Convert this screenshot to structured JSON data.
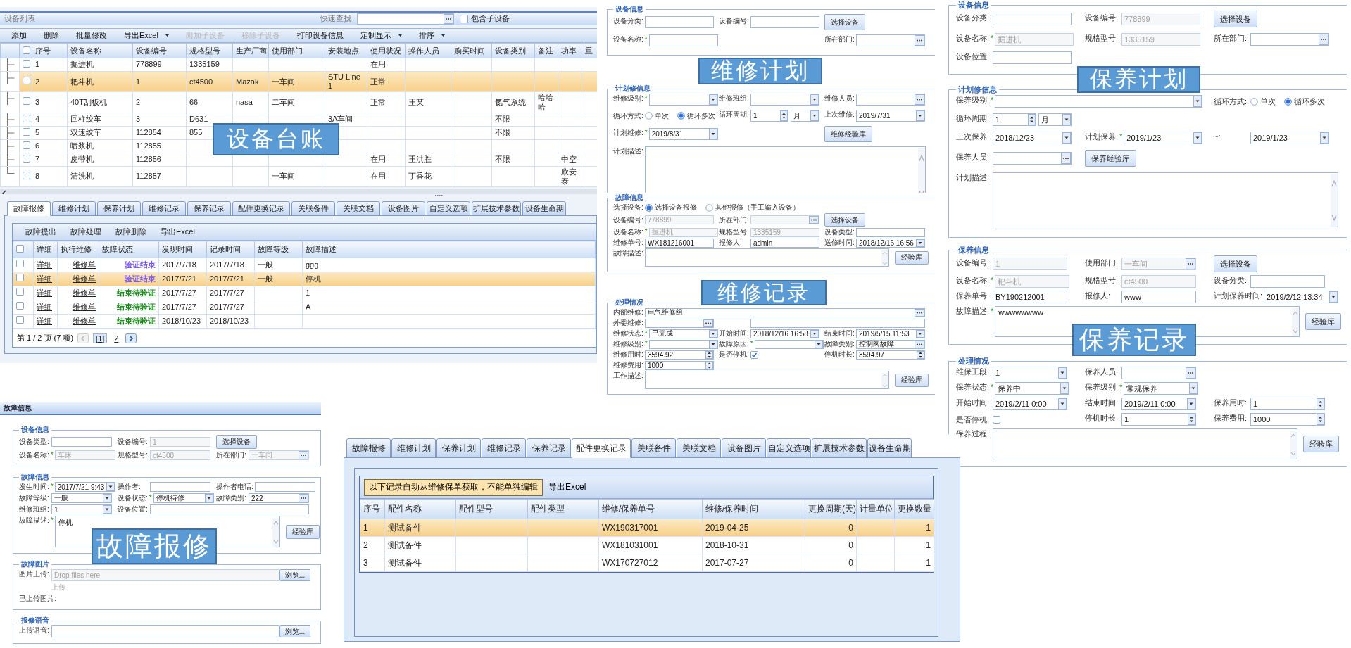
{
  "equipment_list": {
    "title": "设备列表",
    "quick_search_label": "快速查找",
    "include_children": {
      "label": "包含子设备",
      "checked": false
    },
    "toolbar": [
      {
        "label": "添加",
        "disabled": false,
        "dropdown": false
      },
      {
        "label": "删除",
        "disabled": false,
        "dropdown": false
      },
      {
        "label": "批量修改",
        "disabled": false,
        "dropdown": false
      },
      {
        "label": "导出Excel",
        "disabled": false,
        "dropdown": true
      },
      {
        "label": "附加子设备",
        "disabled": true,
        "dropdown": false
      },
      {
        "label": "移除子设备",
        "disabled": true,
        "dropdown": false
      },
      {
        "label": "打印设备信息",
        "disabled": false,
        "dropdown": false
      },
      {
        "label": "定制显示",
        "disabled": false,
        "dropdown": true
      },
      {
        "label": "排序",
        "disabled": false,
        "dropdown": true
      }
    ],
    "select_all": {
      "checked": false
    },
    "columns": [
      "序号",
      "设备名称",
      "设备编号",
      "规格型号",
      "生产厂商",
      "使用部门",
      "安装地点",
      "使用状况",
      "操作人员",
      "购买时间",
      "设备类别",
      "备注",
      "功率",
      "重"
    ],
    "rows": [
      {
        "selected": false,
        "checked": false,
        "cells": [
          "1",
          "掘进机",
          "778899",
          "1335159",
          null,
          null,
          null,
          "在用",
          null,
          null,
          null,
          null,
          null,
          null
        ]
      },
      {
        "selected": true,
        "checked": false,
        "cells": [
          "2",
          "耙斗机",
          "1",
          "ct4500",
          "Mazak",
          "一车间",
          "STU Line1",
          "正常",
          null,
          null,
          null,
          null,
          null,
          null
        ]
      },
      {
        "selected": false,
        "checked": false,
        "cells": [
          "3",
          "40T刮板机",
          "2",
          "66",
          "nasa",
          "二车间",
          null,
          "正常",
          "王某",
          null,
          "氮气系统",
          "哈哈哈",
          null,
          null
        ]
      },
      {
        "selected": false,
        "checked": false,
        "cells": [
          "4",
          "回柱绞车",
          "3",
          "D631",
          null,
          null,
          "3A车间",
          null,
          null,
          null,
          "不限",
          null,
          null,
          null
        ]
      },
      {
        "selected": false,
        "checked": false,
        "cells": [
          "5",
          "双速绞车",
          "112854",
          "855",
          null,
          null,
          null,
          null,
          null,
          null,
          "不限",
          null,
          null,
          null
        ]
      },
      {
        "selected": false,
        "checked": false,
        "cells": [
          "6",
          "喷浆机",
          "112855",
          null,
          null,
          null,
          null,
          null,
          null,
          null,
          null,
          null,
          null,
          null
        ]
      },
      {
        "selected": false,
        "checked": false,
        "cells": [
          "7",
          "皮带机",
          "112856",
          null,
          null,
          null,
          null,
          "在用",
          "王洪胜",
          null,
          "不限",
          null,
          "中空",
          null
        ]
      },
      {
        "selected": false,
        "checked": false,
        "cells": [
          "8",
          "清洗机",
          "112857",
          null,
          null,
          "一车间",
          null,
          "在用",
          "丁香花",
          null,
          null,
          null,
          "欣安泰",
          null
        ]
      }
    ],
    "banner": "设备台账"
  },
  "record_tabs": {
    "tabs": [
      {
        "label": "故障报修",
        "selected": true
      },
      {
        "label": "维修计划",
        "selected": false
      },
      {
        "label": "保养计划",
        "selected": false
      },
      {
        "label": "维修记录",
        "selected": false
      },
      {
        "label": "保养记录",
        "selected": false
      },
      {
        "label": "配件更换记录",
        "selected": false
      },
      {
        "label": "关联备件",
        "selected": false
      },
      {
        "label": "关联文档",
        "selected": false
      },
      {
        "label": "设备图片",
        "selected": false
      },
      {
        "label": "自定义选项",
        "selected": false
      },
      {
        "label": "扩展技术参数",
        "selected": false
      },
      {
        "label": "设备生命期",
        "selected": false
      }
    ],
    "toolbar": [
      "故障提出",
      "故障处理",
      "故障删除",
      "导出Excel"
    ],
    "select_all": {
      "checked": false
    },
    "columns": [
      "详细",
      "执行维修",
      "故障状态",
      "发现时间",
      "记录时间",
      "故障等级",
      "故障描述"
    ],
    "rows": [
      {
        "selected": false,
        "checked": false,
        "detail": "详细",
        "order": "维修单",
        "status": {
          "text": "验证结束",
          "color": "#7b5cf0"
        },
        "found": "2017/7/18",
        "recorded": "2017/7/18",
        "level": "一般",
        "description": "ggg"
      },
      {
        "selected": true,
        "checked": false,
        "detail": "详细",
        "order": "维修单",
        "status": {
          "text": "验证结束",
          "color": "#7b5cf0"
        },
        "found": "2017/7/21",
        "recorded": "2017/7/21",
        "level": "一般",
        "description": "停机"
      },
      {
        "selected": false,
        "checked": false,
        "detail": "详细",
        "order": "维修单",
        "status": {
          "text": "结束待验证",
          "color": "#1a8a1a"
        },
        "found": "2017/7/27",
        "recorded": "2017/7/27",
        "level": null,
        "description": "1"
      },
      {
        "selected": false,
        "checked": false,
        "detail": "详细",
        "order": "维修单",
        "status": {
          "text": "结束待验证",
          "color": "#1a8a1a"
        },
        "found": "2017/7/27",
        "recorded": "2017/7/27",
        "level": null,
        "description": "A"
      },
      {
        "selected": false,
        "checked": false,
        "detail": "详细",
        "order": "维修单",
        "status": {
          "text": "结束待验证",
          "color": "#1a8a1a"
        },
        "found": "2018/10/23",
        "recorded": "2018/10/23",
        "level": null,
        "description": null
      }
    ],
    "pager": {
      "summary": "第 1 / 2 页 (7 项)",
      "prev_disabled": true,
      "pages": [
        {
          "label": "[1]",
          "selected": true
        },
        {
          "label": "2",
          "selected": false
        }
      ]
    }
  },
  "maintenance_plan_form": {
    "banner": "维修计划",
    "sections": [
      {
        "legend": "设备信息",
        "rows": [
          {
            "items": [
              {
                "label": "设备分类:",
                "kind": "text"
              },
              {
                "label": "设备编号:",
                "kind": "text"
              },
              {
                "kind": "button",
                "label": "选择设备"
              }
            ]
          },
          {
            "items": [
              {
                "label": "设备名称:",
                "asterisk": "*",
                "kind": "text"
              },
              {
                "label": "所在部门:",
                "kind": "lookup"
              }
            ]
          }
        ]
      },
      {
        "legend": "计划修信息",
        "rows": [
          {
            "items": [
              {
                "label": "维修级别:",
                "asterisk": "*",
                "kind": "select"
              },
              {
                "label": "维修班组:",
                "kind": "select"
              },
              {
                "label": "维修人员:",
                "kind": "lookup"
              }
            ]
          },
          {
            "items": [
              {
                "label": "循环方式:",
                "kind": "radio",
                "options": [
                  {
                    "label": "单次",
                    "selected": false
                  },
                  {
                    "label": "循环多次",
                    "selected": true
                  }
                ]
              },
              {
                "label": "循环周期:",
                "kind": "spin_unit",
                "value": "1",
                "unit": "月"
              },
              {
                "label": "上次维修:",
                "kind": "date",
                "value": "2019/7/31"
              }
            ]
          },
          {
            "items": [
              {
                "label": "计划维修:",
                "asterisk": "*",
                "kind": "date",
                "value": "2019/8/31"
              },
              {
                "kind": "button",
                "label": "维修经验库"
              }
            ]
          },
          {
            "items": [
              {
                "label": "计划描述:",
                "kind": "textarea"
              }
            ]
          }
        ]
      }
    ]
  },
  "repair_record_form": {
    "banner": "维修记录",
    "sections": [
      {
        "legend": "故障信息",
        "rows": [
          {
            "items": [
              {
                "label": "选择设备:",
                "kind": "radio",
                "options": [
                  {
                    "label": "选择设备报修",
                    "selected": true
                  },
                  {
                    "label": "其他报修（手工输入设备）",
                    "selected": false
                  }
                ]
              }
            ]
          },
          {
            "items": [
              {
                "label": "设备编号:",
                "kind": "text",
                "value": "778899",
                "disabled": true
              },
              {
                "label": "所在部门:",
                "kind": "lookup",
                "disabled": true
              },
              {
                "kind": "button",
                "label": "选择设备"
              }
            ]
          },
          {
            "items": [
              {
                "label": "设备名称:",
                "asterisk": "*",
                "kind": "text",
                "value": "掘进机",
                "disabled": true
              },
              {
                "label": "规格型号:",
                "kind": "text",
                "value": "1335159",
                "disabled": true
              },
              {
                "label": "设备类型:",
                "kind": "text"
              }
            ]
          },
          {
            "items": [
              {
                "label": "维修单号:",
                "kind": "text",
                "value": "WX181216001"
              },
              {
                "label": "报修人:",
                "kind": "text",
                "value": "admin"
              },
              {
                "label": "送修时间:",
                "kind": "date",
                "value": "2018/12/16 16:56"
              }
            ]
          },
          {
            "items": [
              {
                "label": "故障描述:",
                "kind": "textarea",
                "button": "经验库"
              }
            ]
          }
        ]
      },
      {
        "legend": "处理情况",
        "rows": [
          {
            "items": [
              {
                "label": "内部维修:",
                "kind": "long_lookup",
                "value": "电气维修组"
              }
            ]
          },
          {
            "items": [
              {
                "label": "外委维修:",
                "kind": "lookup"
              },
              {
                "kind": "long_text"
              }
            ]
          },
          {
            "items": [
              {
                "label": "维修状态:",
                "asterisk": "*",
                "kind": "select",
                "value": "已完成"
              },
              {
                "label": "开始时间:",
                "kind": "date",
                "value": "2018/12/16 16:58"
              },
              {
                "label": "结束时间:",
                "kind": "date",
                "value": "2019/5/15 11:53"
              }
            ]
          },
          {
            "items": [
              {
                "label": "维修级别:",
                "asterisk": "*",
                "kind": "select"
              },
              {
                "label": "故障原因:",
                "asterisk": "*",
                "kind": "select"
              },
              {
                "label": "故障类别:",
                "kind": "lookup",
                "value": "控制阀故障"
              }
            ]
          },
          {
            "items": [
              {
                "label": "维修用时:",
                "kind": "spin",
                "value": "3594.92"
              },
              {
                "label": "是否停机:",
                "kind": "checkbox",
                "checked": true
              },
              {
                "label": "停机时长:",
                "kind": "spin",
                "value": "3594.97"
              }
            ]
          },
          {
            "items": [
              {
                "label": "维修费用:",
                "kind": "spin",
                "value": "1000"
              }
            ]
          },
          {
            "items": [
              {
                "label": "工作描述:",
                "kind": "textarea",
                "button": "经验库"
              }
            ]
          }
        ]
      }
    ]
  },
  "upkeep_plan_form": {
    "banner": "保养计划",
    "sections": [
      {
        "legend": "设备信息",
        "rows": [
          {
            "items": [
              {
                "label": "设备分类:",
                "kind": "text"
              },
              {
                "label": "设备编号:",
                "kind": "text",
                "value": "778899",
                "disabled": true
              },
              {
                "kind": "button",
                "label": "选择设备"
              }
            ]
          },
          {
            "items": [
              {
                "label": "设备名称:",
                "asterisk": "*",
                "kind": "text",
                "value": "掘进机",
                "disabled": true
              },
              {
                "label": "规格型号:",
                "kind": "text",
                "value": "1335159",
                "disabled": true
              },
              {
                "label": "所在部门:",
                "kind": "lookup"
              }
            ]
          },
          {
            "items": [
              {
                "label": "设备位置:",
                "kind": "text"
              }
            ]
          }
        ]
      },
      {
        "legend": "计划修信息",
        "rows": [
          {
            "items": [
              {
                "label": "保养级别:",
                "asterisk": "*",
                "kind": "long_select"
              },
              {
                "label": "循环方式:",
                "kind": "radio",
                "options": [
                  {
                    "label": "单次",
                    "selected": false
                  },
                  {
                    "label": "循环多次",
                    "selected": true
                  }
                ]
              }
            ]
          },
          {
            "items": [
              {
                "label": "循环周期:",
                "kind": "spin_unit",
                "value": "1",
                "unit": "月"
              }
            ]
          },
          {
            "items": [
              {
                "label": "上次保养:",
                "kind": "date",
                "value": "2018/12/23"
              },
              {
                "label": "计划保养:",
                "asterisk": "*",
                "kind": "date",
                "value": "2019/1/23"
              },
              {
                "label": "~:",
                "kind": "date",
                "value": "2019/1/23"
              }
            ]
          },
          {
            "items": [
              {
                "label": "保养人员:",
                "kind": "lookup"
              },
              {
                "kind": "button",
                "label": "保养经验库"
              }
            ]
          },
          {
            "items": [
              {
                "label": "计划描述:",
                "kind": "textarea"
              }
            ]
          }
        ]
      }
    ]
  },
  "upkeep_record_form": {
    "banner": "保养记录",
    "sections": [
      {
        "legend": "保养信息",
        "rows": [
          {
            "items": [
              {
                "label": "设备编号:",
                "kind": "text",
                "value": "1",
                "disabled": true
              },
              {
                "label": "使用部门:",
                "kind": "lookup",
                "value": "一车间",
                "disabled": true
              },
              {
                "kind": "button",
                "label": "选择设备"
              }
            ]
          },
          {
            "items": [
              {
                "label": "设备名称:",
                "asterisk": "*",
                "kind": "text",
                "value": "耙斗机",
                "disabled": true
              },
              {
                "label": "规格型号:",
                "kind": "text",
                "value": "ct4500",
                "disabled": true
              },
              {
                "label": "设备分类:",
                "kind": "text"
              }
            ]
          },
          {
            "items": [
              {
                "label": "保养单号:",
                "kind": "text",
                "value": "BY190212001"
              },
              {
                "label": "报修人:",
                "kind": "text",
                "value": "www"
              },
              {
                "label": "计划保养时间:",
                "kind": "date",
                "value": "2019/2/12 13:34"
              }
            ]
          },
          {
            "items": [
              {
                "label": "故障描述:",
                "asterisk": "*",
                "kind": "textarea",
                "value": "wwwwwwww",
                "button": "经验库"
              }
            ]
          }
        ]
      },
      {
        "legend": "处理情况",
        "rows": [
          {
            "items": [
              {
                "label": "维保工段:",
                "kind": "select",
                "value": "1"
              },
              {
                "label": "保养人员:",
                "kind": "lookup"
              }
            ]
          },
          {
            "items": [
              {
                "label": "保养状态:",
                "asterisk": "*",
                "kind": "select",
                "value": "保养中"
              },
              {
                "label": "保养级别:",
                "asterisk": "*",
                "kind": "select",
                "value": "常规保养"
              }
            ]
          },
          {
            "items": [
              {
                "label": "开始时间:",
                "kind": "date",
                "value": "2019/2/11 0:00"
              },
              {
                "label": "结束时间:",
                "kind": "date",
                "value": "2019/2/11 0:00"
              },
              {
                "label": "保养用时:",
                "kind": "spin",
                "value": "1"
              }
            ]
          },
          {
            "items": [
              {
                "label": "是否停机:",
                "kind": "checkbox",
                "checked": false
              },
              {
                "label": "停机时长:",
                "kind": "spin",
                "value": "1"
              },
              {
                "label": "保养费用:",
                "kind": "spin",
                "value": "1000"
              }
            ]
          },
          {
            "items": [
              {
                "label": "保养过程:",
                "kind": "textarea",
                "button": "经验库"
              }
            ]
          }
        ]
      }
    ]
  },
  "fault_report_form": {
    "header": "故障信息",
    "banner": "故障报修",
    "sections": [
      {
        "legend": "设备信息",
        "rows": [
          {
            "items": [
              {
                "label": "设备类型:",
                "kind": "text"
              },
              {
                "label": "设备编号:",
                "kind": "text",
                "value": "1",
                "disabled": true
              },
              {
                "kind": "button",
                "label": "选择设备"
              }
            ]
          },
          {
            "items": [
              {
                "label": "设备名称:",
                "asterisk": "*",
                "kind": "text",
                "value": "车床",
                "disabled": true
              },
              {
                "label": "规格型号:",
                "kind": "text",
                "value": "ct4500",
                "disabled": true
              },
              {
                "label": "所在部门:",
                "kind": "lookup",
                "value": "一车间",
                "disabled": true
              }
            ]
          }
        ]
      },
      {
        "legend": "故障信息",
        "rows": [
          {
            "items": [
              {
                "label": "发生时间:",
                "asterisk": "*",
                "kind": "date",
                "value": "2017/7/21 9:43"
              },
              {
                "label": "操作者:",
                "kind": "text"
              },
              {
                "label": "操作者电话:",
                "kind": "text"
              }
            ]
          },
          {
            "items": [
              {
                "label": "故障等级:",
                "kind": "select",
                "value": "一般"
              },
              {
                "label": "设备状态:",
                "asterisk": "*",
                "kind": "select",
                "value": "停机待修"
              },
              {
                "label": "故障类别:",
                "kind": "lookup",
                "value": "222"
              }
            ]
          },
          {
            "items": [
              {
                "label": "维修班组:",
                "kind": "select",
                "value": "1"
              },
              {
                "label": "设备位置:",
                "kind": "long_text"
              }
            ]
          },
          {
            "items": [
              {
                "label": "故障描述:",
                "asterisk": "*",
                "kind": "textarea",
                "value": "停机",
                "button": "经验库"
              }
            ]
          }
        ]
      },
      {
        "legend": "故障图片",
        "rows": [
          {
            "items": [
              {
                "label": "图片上传:",
                "kind": "upload",
                "placeholder": "Drop files here",
                "button": "浏览..."
              }
            ]
          },
          {
            "items": [
              {
                "kind": "note",
                "text": "上传"
              }
            ]
          },
          {
            "items": [
              {
                "kind": "label",
                "label": "已上传图片:"
              }
            ]
          }
        ]
      },
      {
        "legend": "报修语音",
        "rows": [
          {
            "items": [
              {
                "label": "上传语音:",
                "kind": "upload",
                "button": "浏览..."
              }
            ]
          }
        ]
      }
    ]
  },
  "parts_tabs": {
    "tabs": [
      {
        "label": "故障报修",
        "selected": false
      },
      {
        "label": "维修计划",
        "selected": false
      },
      {
        "label": "保养计划",
        "selected": false
      },
      {
        "label": "维修记录",
        "selected": false
      },
      {
        "label": "保养记录",
        "selected": false
      },
      {
        "label": "配件更换记录",
        "selected": true
      },
      {
        "label": "关联备件",
        "selected": false
      },
      {
        "label": "关联文档",
        "selected": false
      },
      {
        "label": "设备图片",
        "selected": false
      },
      {
        "label": "自定义选项",
        "selected": false
      },
      {
        "label": "扩展技术参数",
        "selected": false
      },
      {
        "label": "设备生命期",
        "selected": false
      }
    ],
    "notice": "以下记录自动从维修保单获取，不能单独编辑",
    "export": "导出Excel",
    "columns": [
      "序号",
      "配件名称",
      "配件型号",
      "配件类型",
      "维修/保养单号",
      "维修/保养时间",
      "更换周期(天)",
      "计量单位",
      "更换数量"
    ],
    "rows": [
      {
        "selected": true,
        "cells": [
          "1",
          "测试备件",
          null,
          null,
          "WX190317001",
          "2019-04-25",
          "0",
          null,
          "1"
        ]
      },
      {
        "selected": false,
        "cells": [
          "2",
          "测试备件",
          null,
          null,
          "WX181031001",
          "2018-10-31",
          "0",
          null,
          "1"
        ]
      },
      {
        "selected": false,
        "cells": [
          "3",
          "测试备件",
          null,
          null,
          "WX170727012",
          "2017-07-27",
          "0",
          null,
          "1"
        ]
      }
    ]
  }
}
